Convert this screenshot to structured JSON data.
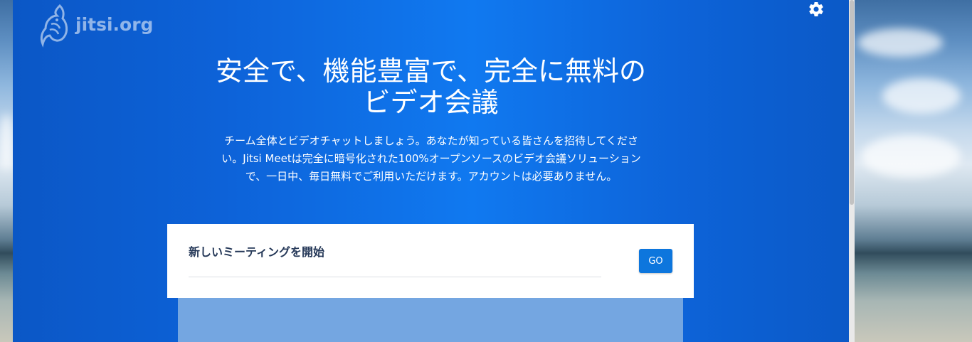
{
  "logo": {
    "text": "jitsi.org"
  },
  "header": {
    "title_line1": "安全で、機能豊富で、完全に無料の",
    "title_line2": "ビデオ会議",
    "description_line1": "チーム全体とビデオチャットしましょう。あなたが知っている皆さんを招待してくださ",
    "description_line2": "い。Jitsi Meetは完全に暗号化された100%オープンソースのビデオ会議ソリューション",
    "description_line3": "で、一日中、毎日無料でご利用いただけます。アカウントは必要ありません。"
  },
  "start_meeting": {
    "label": "新しいミーティングを開始",
    "input_value": "",
    "go_label": "GO"
  },
  "icons": {
    "settings": "gear-icon",
    "logo": "jitsi-logo-icon"
  },
  "colors": {
    "background_blue": "#0d62d8",
    "go_button": "#0d76dd",
    "card": "#ffffff",
    "lower_panel": "#74a6e1"
  }
}
